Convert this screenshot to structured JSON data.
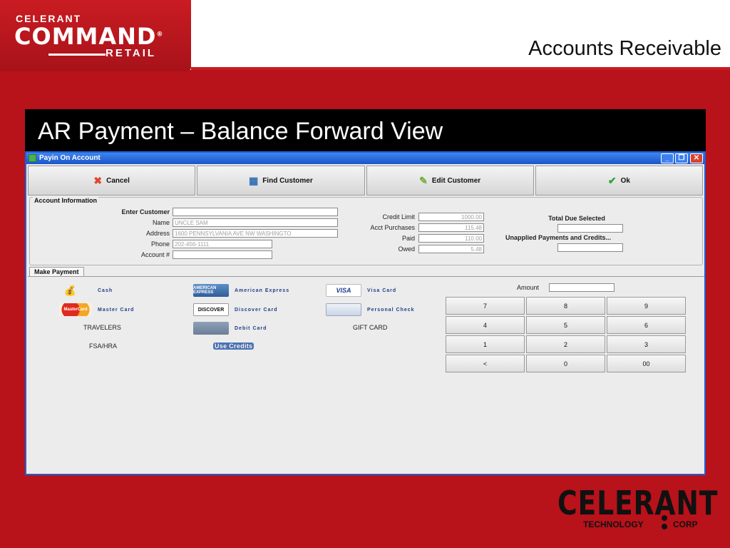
{
  "header": {
    "logo_top": "CELERANT",
    "logo_main": "COMMAND",
    "logo_reg": "®",
    "logo_bottom": "RETAIL",
    "section_title": "Accounts Receivable",
    "brand_color": "#b8121a"
  },
  "slide_title": "AR Payment – Balance Forward View",
  "window": {
    "title": "Payin On Account",
    "controls": {
      "minimize": "_",
      "restore": "❐",
      "close": "✕"
    }
  },
  "toolbar": {
    "buttons": [
      {
        "label": "Cancel",
        "icon": "cancel-icon"
      },
      {
        "label": "Find Customer",
        "icon": "find-customer-icon"
      },
      {
        "label": "Edit Customer",
        "icon": "edit-customer-icon"
      },
      {
        "label": "Ok",
        "icon": "check-icon"
      }
    ]
  },
  "account_info": {
    "legend": "Account Information",
    "enter_customer_label": "Enter Customer",
    "enter_customer_value": "",
    "name_label": "Name",
    "name_value": "UNCLE SAM",
    "address_label": "Address",
    "address_value": "1600 PENNSYLVANIA AVE NW  WASHINGTO",
    "phone_label": "Phone",
    "phone_value": "202-456-1111",
    "account_label": "Account #",
    "account_value": "",
    "credit_limit_label": "Credit Limit",
    "credit_limit_value": "1000.00",
    "acct_purchases_label": "Acct Purchases",
    "acct_purchases_value": "115.48",
    "paid_label": "Paid",
    "paid_value": "110.00",
    "owed_label": "Owed",
    "owed_value": "5.48",
    "total_due_label": "Total Due Selected",
    "total_due_value": "",
    "unapplied_label": "Unapplied Payments and Credits...",
    "unapplied_value": ""
  },
  "payment": {
    "tab_label": "Make Payment",
    "methods": {
      "cash": "Cash",
      "amex": "American Express",
      "visa": "Visa Card",
      "mastercard": "Master Card",
      "discover": "Discover Card",
      "check": "Personal Check",
      "travelers": "TRAVELERS",
      "debit": "Debit Card",
      "gift": "GIFT CARD",
      "fsa": "FSA/HRA",
      "use_credits": "Use Credits"
    },
    "card_text": {
      "amex": "AMERICAN EXPRESS",
      "visa": "VISA",
      "mastercard": "MasterCard",
      "discover": "DISCOVER"
    },
    "amount_label": "Amount",
    "amount_value": "",
    "keypad": [
      "7",
      "8",
      "9",
      "4",
      "5",
      "6",
      "1",
      "2",
      "3",
      "<",
      "0",
      "00"
    ]
  },
  "footer": {
    "logo_main": "CELERANT",
    "logo_reg": "®",
    "logo_left": "TECHNOLOGY",
    "logo_right": "CORP"
  }
}
